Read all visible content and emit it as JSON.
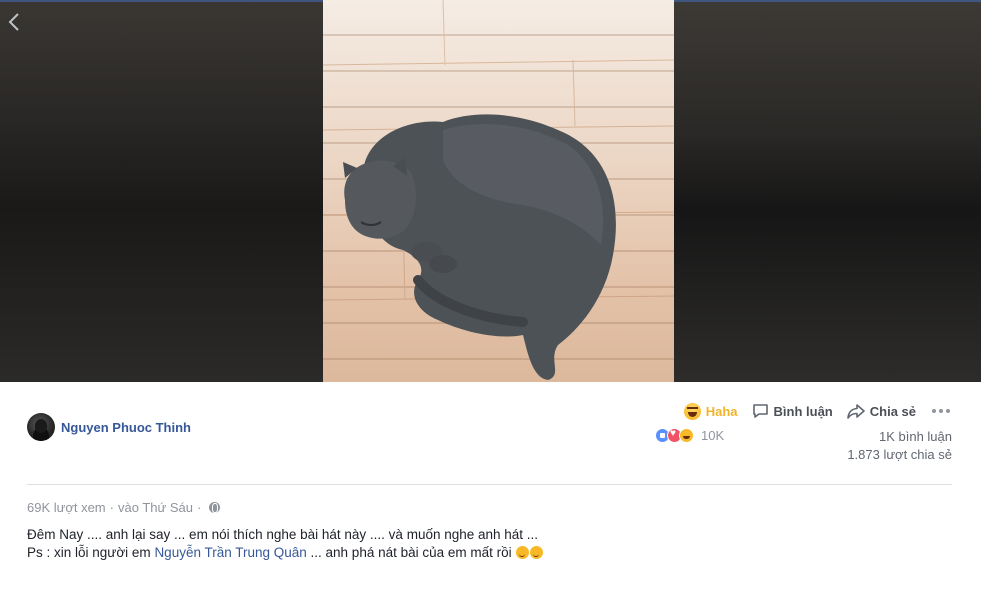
{
  "author": {
    "name": "Nguyen Phuoc Thinh"
  },
  "actions": {
    "reaction_label": "Haha",
    "comment_label": "Bình luận",
    "share_label": "Chia sẻ"
  },
  "reactions": {
    "count": "10K"
  },
  "stats": {
    "comments": "1K bình luận",
    "shares": "1.873 lượt chia sẻ"
  },
  "meta": {
    "views": "69K lượt xem",
    "separator": "·",
    "time": "vào Thứ Sáu",
    "separator2": "·"
  },
  "post": {
    "line1": "Đêm Nay .... anh lại say ... em nói thích nghe bài hát này .... và muốn nghe anh hát ...",
    "line2_prefix": "Ps : xin lỗi người em ",
    "line2_tag": "Nguyễn Trần Trung Quân",
    "line2_suffix": " ... anh phá nát bài của em mất rồi "
  },
  "colors": {
    "link": "#365899",
    "haha": "#f0b429",
    "muted": "#90949c",
    "divider": "#dddfe2"
  },
  "icons": {
    "back": "chevron-left-icon",
    "haha": "haha-emoji-icon",
    "comment": "comment-bubble-icon",
    "share": "share-arrow-icon",
    "more": "more-dots-icon",
    "privacy": "globe-icon"
  }
}
